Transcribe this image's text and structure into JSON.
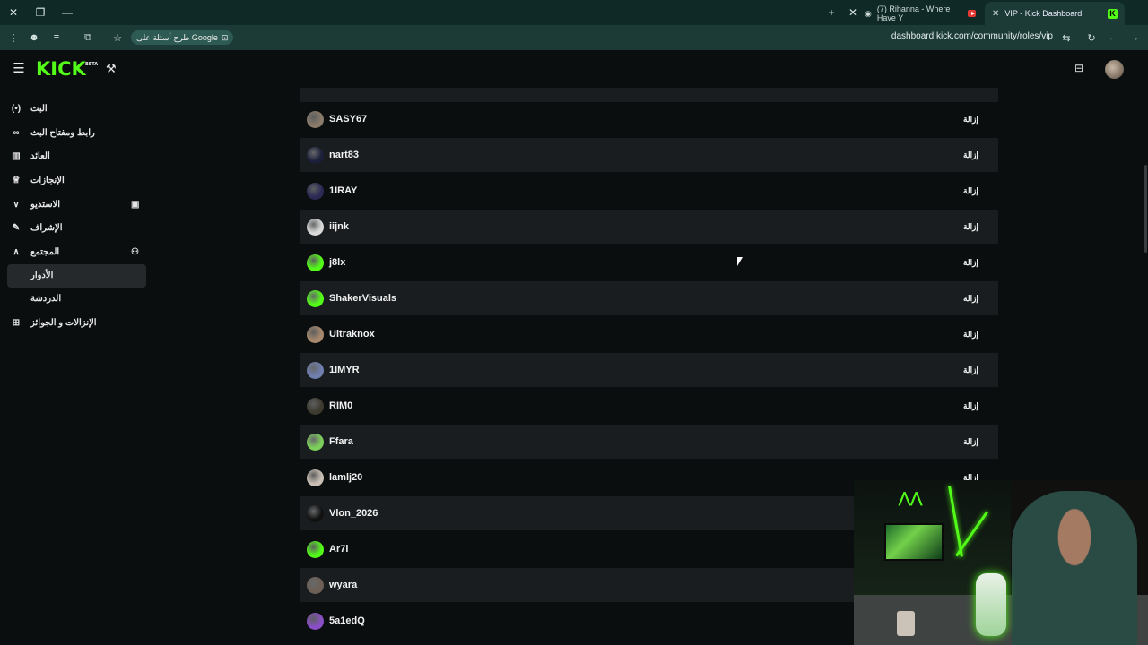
{
  "browser": {
    "tabs": [
      {
        "label": "(7) Rihanna - Where Have Y",
        "icon": "youtube-icon"
      },
      {
        "label": "VIP - Kick Dashboard",
        "icon": "kick-icon"
      }
    ],
    "omnibox_chip": "طرح أسئلة على Google",
    "url": "dashboard.kick.com/community/roles/vip"
  },
  "app": {
    "logo": "KICK",
    "logo_badge": "BETA",
    "brand_color": "#53fc18"
  },
  "sidebar": {
    "items": [
      {
        "label": "البث",
        "icon": "broadcast-icon"
      },
      {
        "label": "رابط ومفتاح البث",
        "icon": "link-icon"
      },
      {
        "label": "العائد",
        "icon": "chart-icon"
      },
      {
        "label": "الإنجازات",
        "icon": "trophy-icon"
      },
      {
        "label": "الاستديو",
        "icon": "chevron-down-icon"
      },
      {
        "label": "الإشراف",
        "icon": "wrench-icon"
      },
      {
        "label": "المجتمع",
        "icon": "chevron-up-icon"
      }
    ],
    "sub_items": [
      {
        "label": "الأدوار"
      },
      {
        "label": "الدردشة"
      }
    ],
    "last_item": {
      "label": "الإنزالات و الجوائز",
      "icon": "gift-icon"
    }
  },
  "vip_list": {
    "remove_label": "إزالة",
    "rows": [
      {
        "username": "SASY67",
        "avatar_color": "#8a7b6a"
      },
      {
        "username": "nart83",
        "avatar_color": "#1b1f3a"
      },
      {
        "username": "1IRAY",
        "avatar_color": "#2c2a55"
      },
      {
        "username": "iijnk",
        "avatar_color": "#d9d9d9"
      },
      {
        "username": "j8lx",
        "avatar_color": "#53fc18"
      },
      {
        "username": "ShakerVisuals",
        "avatar_color": "#53fc18"
      },
      {
        "username": "Ultraknox",
        "avatar_color": "#a8896d"
      },
      {
        "username": "1IMYR",
        "avatar_color": "#6f7fb0"
      },
      {
        "username": "RIM0",
        "avatar_color": "#3d3a2e"
      },
      {
        "username": "Ffara",
        "avatar_color": "#7dcf5a"
      },
      {
        "username": "lamlj20",
        "avatar_color": "#c9bfb4"
      },
      {
        "username": "Vlon_2026",
        "avatar_color": "#111111"
      },
      {
        "username": "Ar7l",
        "avatar_color": "#53fc18"
      },
      {
        "username": "wyara",
        "avatar_color": "#6d5f55"
      },
      {
        "username": "5a1edQ",
        "avatar_color": "#8a4fc7"
      }
    ]
  }
}
